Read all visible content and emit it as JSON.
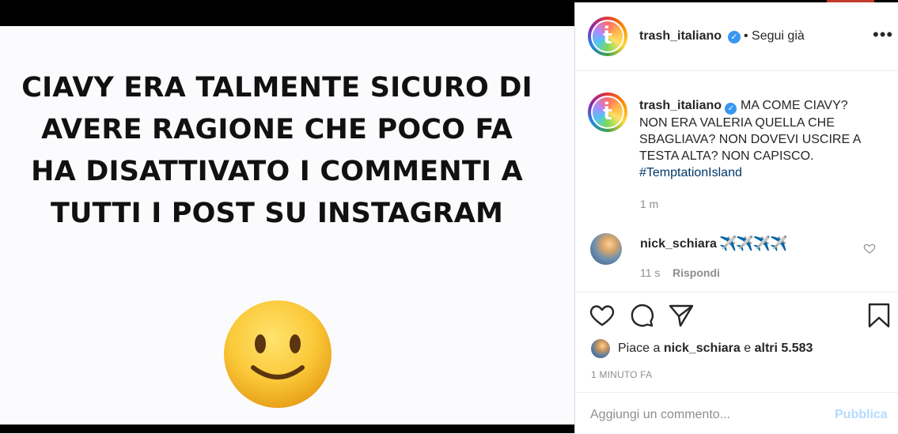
{
  "post": {
    "image_text": "CIAVY ERA TALMENTE SICURO DI\nAVERE RAGIONE CHE POCO FA\nHA DISATTIVATO I COMMENTI A\nTUTTI I POST SU INSTAGRAM",
    "emoji": "slightly-smiling-face-emoji"
  },
  "header": {
    "username": "trash_italiano",
    "verified_icon": "verified-badge-icon",
    "follow_status": "• Segui già",
    "more_label": "•••"
  },
  "caption": {
    "username": "trash_italiano",
    "text": "MA COME CIAVY? NON ERA VALERIA QUELLA CHE SBAGLIAVA? NON DOVEVI USCIRE A TESTA ALTA? NON CAPISCO.",
    "hashtag": "#TemptationIsland",
    "time": "1 m"
  },
  "comment": {
    "username": "nick_schiara",
    "text": "✈️✈️✈️✈️",
    "time": "11 s",
    "reply_label": "Rispondi"
  },
  "actions": {
    "icons": [
      "heart-icon",
      "comment-icon",
      "share-icon",
      "bookmark-icon"
    ]
  },
  "likes": {
    "prefix": "Piace a",
    "user": "nick_schiara",
    "middle": "e",
    "others": "altri 5.583"
  },
  "post_date": "1 MINUTO FA",
  "add_comment": {
    "placeholder": "Aggiungi un commento...",
    "publish_label": "Pubblica"
  },
  "colors": {
    "link": "#00376b",
    "muted": "#8e8e8e",
    "verified": "#3897f0",
    "publish_disabled": "#b3dbff"
  }
}
